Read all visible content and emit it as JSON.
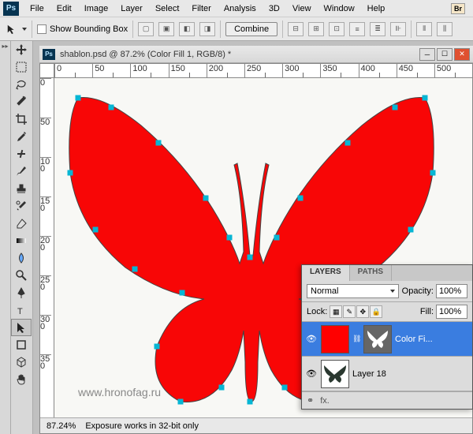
{
  "menubar": {
    "items": [
      "File",
      "Edit",
      "Image",
      "Layer",
      "Select",
      "Filter",
      "Analysis",
      "3D",
      "View",
      "Window",
      "Help"
    ],
    "bridge": "Br"
  },
  "options": {
    "show_bounding_box": "Show Bounding Box",
    "combine": "Combine"
  },
  "document": {
    "title": "shablon.psd @ 87.2% (Color Fill 1, RGB/8) *",
    "ruler_h": [
      "0",
      "50",
      "100",
      "150",
      "200",
      "250",
      "300",
      "350",
      "400",
      "450",
      "500"
    ],
    "ruler_v": [
      "0",
      "50",
      "100",
      "150",
      "200",
      "250",
      "300",
      "350"
    ]
  },
  "status": {
    "zoom": "87.24%",
    "info": "Exposure works in 32-bit only"
  },
  "watermark": "www.hronofag.ru",
  "layers": {
    "tabs": [
      "LAYERS",
      "PATHS"
    ],
    "blend": "Normal",
    "opacity_label": "Opacity:",
    "opacity": "100%",
    "lock_label": "Lock:",
    "fill_label": "Fill:",
    "fill": "100%",
    "rows": [
      {
        "name": "Color Fi..."
      },
      {
        "name": "Layer 18"
      }
    ],
    "footer": "fx."
  }
}
